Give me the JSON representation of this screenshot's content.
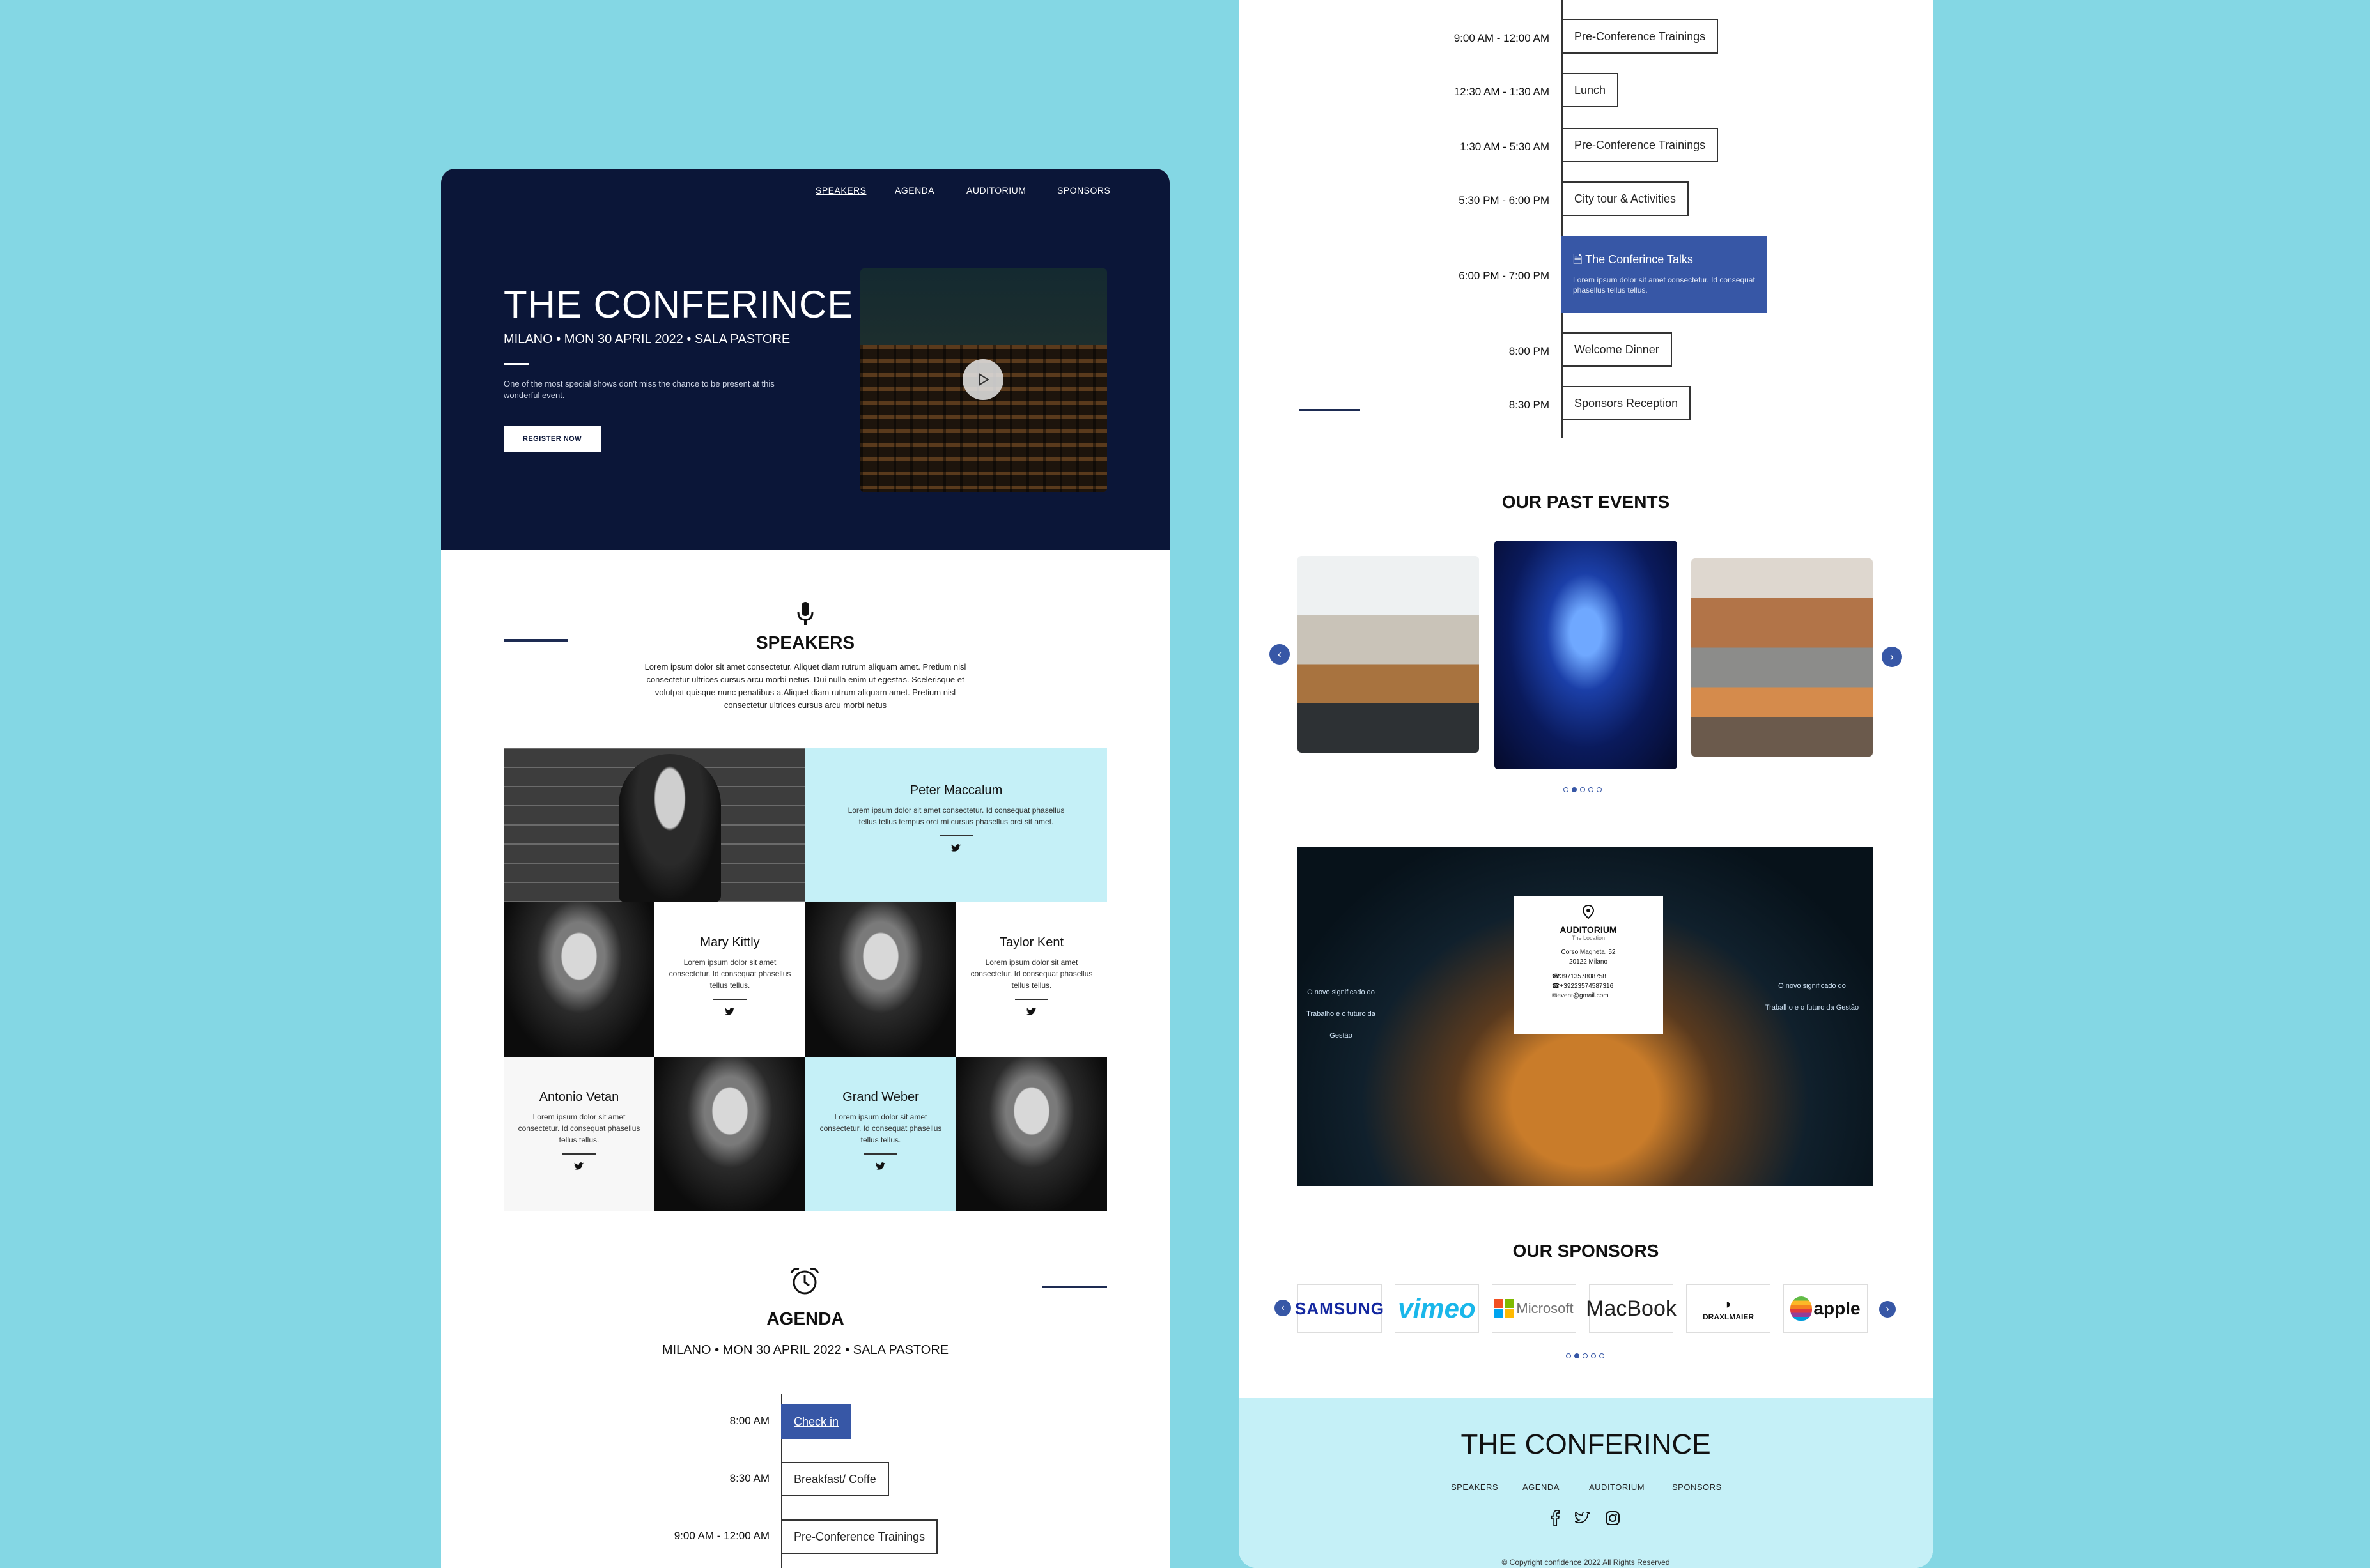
{
  "colors": {
    "background": "#84d7e4",
    "hero": "#0b1638",
    "accent": "#3757a6",
    "light_blue": "#c5f0f7"
  },
  "nav": {
    "speakers": "SPEAKERS",
    "agenda": "AGENDA",
    "auditorium": "AUDITORIUM",
    "sponsors": "SPONSORS"
  },
  "hero": {
    "title": "THE CONFERINCE",
    "subtitle": "MILANO • MON 30 APRIL 2022 • SALA PASTORE",
    "description": "One of the most special shows don't miss the chance to be present at this wonderful event.",
    "cta": "REGISTER NOW",
    "video_icon": "play-icon"
  },
  "speakers": {
    "icon": "microphone-icon",
    "title": "SPEAKERS",
    "description": "Lorem ipsum dolor sit amet consectetur. Aliquet diam rutrum aliquam amet. Pretium nisl consectetur ultrices cursus arcu morbi netus. Dui nulla enim ut egestas. Scelerisque et volutpat quisque nunc penatibus a.Aliquet diam rutrum aliquam amet. Pretium nisl consectetur ultrices cursus arcu morbi netus",
    "people": [
      {
        "name": "Peter Maccalum",
        "bio": "Lorem ipsum dolor sit amet consectetur. Id consequat phasellus tellus tellus tempus orci mi cursus phasellus orci sit amet.",
        "social": "twitter-icon"
      },
      {
        "name": "Mary Kittly",
        "bio": "Lorem ipsum dolor sit amet consectetur. Id consequat phasellus tellus tellus.",
        "social": "twitter-icon"
      },
      {
        "name": "Taylor  Kent",
        "bio": "Lorem ipsum dolor sit amet consectetur. Id consequat phasellus tellus tellus.",
        "social": "twitter-icon"
      },
      {
        "name": "Antonio Vetan",
        "bio": "Lorem ipsum dolor sit amet consectetur. Id consequat phasellus tellus tellus.",
        "social": "twitter-icon"
      },
      {
        "name": "Grand Weber",
        "bio": "Lorem ipsum dolor sit amet consectetur. Id consequat phasellus tellus tellus.",
        "social": "twitter-icon"
      }
    ]
  },
  "agenda": {
    "icon": "alarm-clock-icon",
    "title": "AGENDA",
    "subtitle": "MILANO • MON 30 APRIL 2022 • SALA PASTORE",
    "left_items": [
      {
        "time": "8:00 AM",
        "label": "Check in"
      },
      {
        "time": "8:30 AM",
        "label": "Breakfast/ Coffe"
      },
      {
        "time": "9:00 AM - 12:00 AM",
        "label": "Pre-Conference Trainings"
      }
    ],
    "right_items": [
      {
        "time": "9:00 AM - 12:00 AM",
        "label": "Pre-Conference Trainings"
      },
      {
        "time": "12:30 AM - 1:30 AM",
        "label": "Lunch"
      },
      {
        "time": "1:30 AM - 5:30 AM",
        "label": "Pre-Conference Trainings"
      },
      {
        "time": "5:30 PM - 6:00 PM",
        "label": "City tour & Activities"
      },
      {
        "time": "6:00 PM - 7:00 PM",
        "label": "The Conferince Talks",
        "detail": "Lorem ipsum dolor sit amet consectetur. Id consequat phasellus tellus tellus."
      },
      {
        "time": "8:00 PM",
        "label": "Welcome Dinner"
      },
      {
        "time": "8:30 PM",
        "label": "Sponsors Reception"
      }
    ]
  },
  "past_events": {
    "title": "OUR PAST EVENTS",
    "prev_icon": "chevron-left-icon",
    "next_icon": "chevron-right-icon"
  },
  "auditorium": {
    "pin_icon": "location-pin-icon",
    "title": "AUDITORIUM",
    "caption": "The Location",
    "address1": "Corso Magneta, 52",
    "address2": "20122 Milano",
    "phone1": "3971357808758",
    "phone2": "+39223574587316",
    "email": "event@gmail.com",
    "screen_text": "O novo significado do Trabalho e o futuro da Gestão"
  },
  "sponsors": {
    "title": "OUR SPONSORS",
    "logos": [
      "SAMSUNG",
      "vimeo",
      "Microsoft",
      "MacBook",
      "DRAXLMAIER",
      "apple"
    ]
  },
  "footer": {
    "brand": "THE CONFERINCE",
    "copyright": "© Copyright confidence 2022 All Rights Reserved",
    "social": [
      "facebook-icon",
      "twitter-icon",
      "instagram-icon"
    ]
  }
}
